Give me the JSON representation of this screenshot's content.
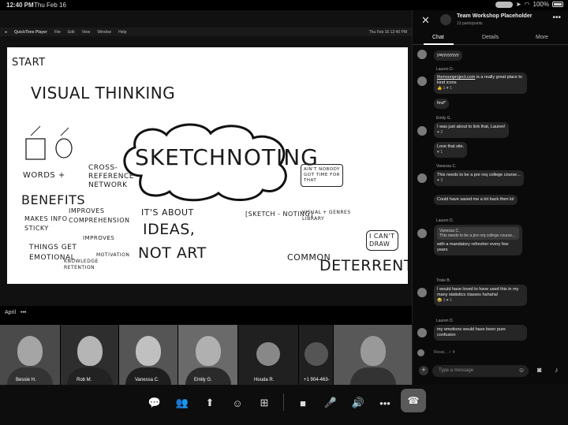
{
  "status_bar": {
    "time": "12:40 PM",
    "date": "Thu Feb 16",
    "battery": "100%"
  },
  "mac_menu": {
    "app": "QuickTime Player",
    "items": [
      "File",
      "Edit",
      "View",
      "Window",
      "Help"
    ],
    "clock": "Thu Feb 16  12:40 PM"
  },
  "slide": {
    "start": "START",
    "visual_thinking": "VISUAL THINKING",
    "sketchnoting": "SKETCHNOTING",
    "words_plus": "WORDS +",
    "cross_reference": "CROSS-\nREFERENCE\nNETWORK",
    "benefits": "BENEFITS",
    "makes_info_sticky": "MAKES INFO\nSTICKY",
    "improves_comprehension": "IMPROVES\nCOMPREHENSION",
    "things_get_emotional": "THINGS GET\nEMOTIONAL",
    "improves": "IMPROVES",
    "knowledge_retention": "KNOWLEDGE\nRETENTION",
    "motivation": "MOTIVATION",
    "ideas_not_art_1": "IT'S ABOUT",
    "ideas_not_art_2": "IDEAS,",
    "ideas_not_art_3": "NOT ART",
    "sketch_noting": "[SKETCH - NOTING]",
    "visual_library": "VISUAL\nLIBRARY",
    "genres": "+ GENRES",
    "aint_nobody": "AIN'T NOBODY\nGOT TIME FOR\nTHAT",
    "i_cant_draw": "I CAN'T\nDRAW",
    "common_deterrents_1": "COMMON",
    "common_deterrents_2": "DETERRENTS"
  },
  "view_label": {
    "name": "April",
    "more": "•••"
  },
  "participants": [
    {
      "name": "Bessie H."
    },
    {
      "name": "Rob M."
    },
    {
      "name": "Vanessa C."
    },
    {
      "name": "Emily G."
    },
    {
      "name": "Houda R."
    },
    {
      "name": "+1 904-463-"
    },
    {
      "name": ""
    }
  ],
  "chat": {
    "title": "Team Workshop Placeholder",
    "subtitle": "13 participants",
    "tabs": [
      "Chat",
      "Details",
      "More"
    ],
    "messages": [
      {
        "sender": "",
        "text": "yayyyyyyyy"
      },
      {
        "sender": "Lauren D.",
        "link": "thenounproject.com",
        "text": " is a really great place to kind icons",
        "react": "👍 1   ♥ 1"
      },
      {
        "sender": "",
        "text": "find*"
      },
      {
        "sender": "Emily G.",
        "text": "I was just about to link that, Lauren!",
        "react": "♥ 2"
      },
      {
        "sender": "",
        "text": "Love that site.",
        "react": "♥ 1"
      },
      {
        "sender": "Vanessa C.",
        "text": "This needs to be a pre req college course...",
        "react": "♥ 3"
      },
      {
        "sender": "",
        "text": "Could have saved me a lot back then lol"
      },
      {
        "sender": "Lauren D.",
        "quote_author": "Vanessa C.",
        "quote": "This needs to be a pre req college course...",
        "text": "with a mandatory refresher every few years"
      },
      {
        "sender": "Trisle B.",
        "text": "I would have loved to have used this in my many statistics classes hahaha!",
        "react": "😂 1   ♥ 1"
      },
      {
        "sender": "Lauren D.",
        "text": "my emotions would have been pure confusion"
      }
    ],
    "seen": "Rosal...  ✓ 4",
    "compose_placeholder": "Type a message"
  },
  "toolbar": {
    "icons": [
      "chat-icon",
      "participants-icon",
      "share-icon",
      "reactions-icon",
      "apps-icon",
      "camera-icon",
      "mic-off-icon",
      "speaker-icon",
      "more-icon",
      "end-call-icon"
    ]
  }
}
